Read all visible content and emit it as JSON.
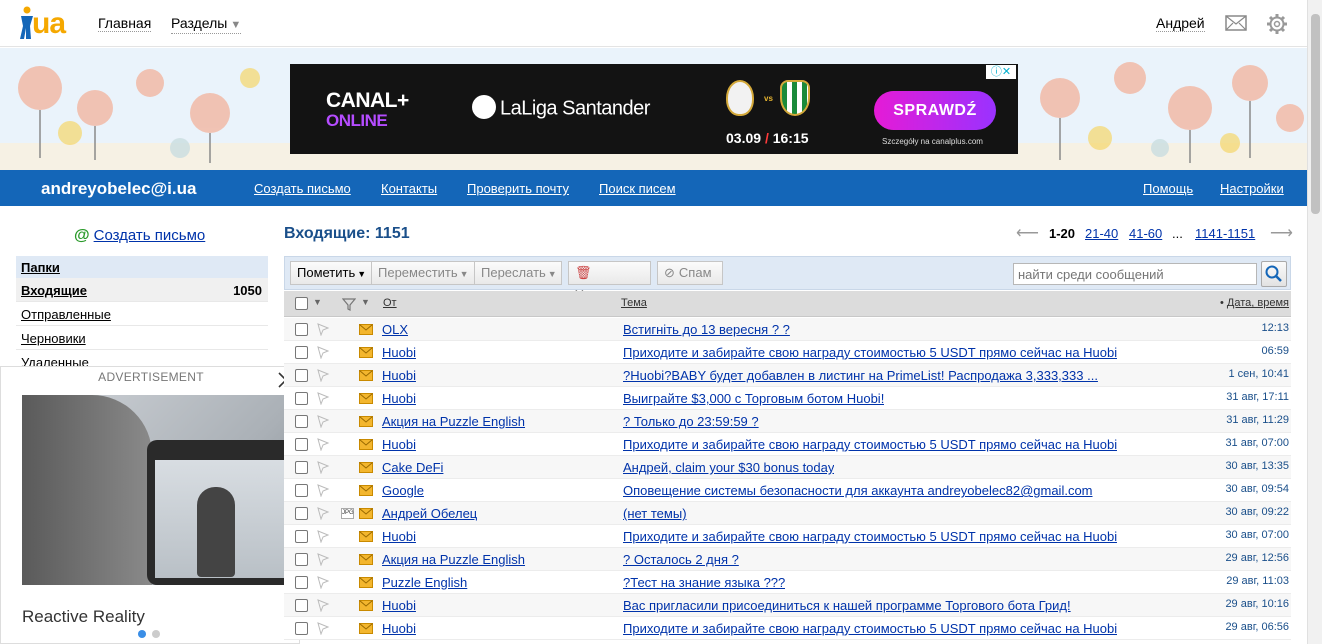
{
  "header": {
    "logo_text": "ua",
    "nav_main": "Главная",
    "nav_sections": "Разделы",
    "user_name": "Андрей"
  },
  "banner_ad": {
    "brand": "CANAL+",
    "brand_sub": "ONLINE",
    "league": "LaLiga Santander",
    "vs": "vs",
    "date": "03.09",
    "time": "16:15",
    "cta": "SPRAWDŹ",
    "small": "Szczegóły na canalplus.com"
  },
  "bluebar": {
    "email": "andreyobelec@i.ua",
    "links": [
      "Создать письмо",
      "Контакты",
      "Проверить почту",
      "Поиск писем"
    ],
    "help": "Помощь",
    "settings": "Настройки"
  },
  "sidebar": {
    "compose": "Создать письмо",
    "folders_header": "Папки",
    "folders": [
      {
        "label": "Входящие",
        "count": "1050"
      },
      {
        "label": "Отправленные",
        "count": ""
      },
      {
        "label": "Черновики",
        "count": ""
      },
      {
        "label": "Удаленные",
        "count": ""
      }
    ]
  },
  "float_ad": {
    "label": "ADVERTISEMENT",
    "caption": "Reactive Reality"
  },
  "inbox": {
    "title": "Входящие: 1151",
    "pager": {
      "current": "1-20",
      "pages": [
        "21-40",
        "41-60",
        "1141-1151"
      ],
      "ellipsis": "..."
    }
  },
  "toolbar": {
    "mark": "Пометить",
    "move": "Переместить",
    "forward": "Переслать",
    "delete": "Удалить",
    "spam": "Спам",
    "search_placeholder": "найти среди сообщений"
  },
  "columns": {
    "from": "От",
    "subject": "Тема",
    "date": "Дата, время"
  },
  "messages": [
    {
      "from": "OLX",
      "subject": "Встигніть до 13 вересня ? ?",
      "date": "12:13",
      "attach": false
    },
    {
      "from": "Huobi",
      "subject": "Приходите и забирайте свою награду стоимостью 5 USDT прямо сейчас на Huobi",
      "date": "06:59",
      "attach": false
    },
    {
      "from": "Huobi",
      "subject": "?Huobi?BABY будет добавлен в листинг на PrimeList! Распродажа 3,333,333 ...",
      "date": "1 сен, 10:41",
      "attach": false
    },
    {
      "from": "Huobi",
      "subject": "Выиграйте $3,000 с Торговым ботом Huobi!",
      "date": "31 авг, 17:11",
      "attach": false
    },
    {
      "from": "Акция на Puzzle English",
      "subject": "? Только до 23:59:59 ?",
      "date": "31 авг, 11:29",
      "attach": false
    },
    {
      "from": "Huobi",
      "subject": "Приходите и забирайте свою награду стоимостью 5 USDT прямо сейчас на Huobi",
      "date": "31 авг, 07:00",
      "attach": false
    },
    {
      "from": "Cake DeFi",
      "subject": "Андрей, claim your $30 bonus today",
      "date": "30 авг, 13:35",
      "attach": false
    },
    {
      "from": "Google",
      "subject": "Оповещение системы безопасности для аккаунта andreyobelec82@gmail.com",
      "date": "30 авг, 09:54",
      "attach": false
    },
    {
      "from": "Андрей Обелец",
      "subject": "(нет темы)",
      "date": "30 авг, 09:22",
      "attach": true,
      "attach_label": "JPG"
    },
    {
      "from": "Huobi",
      "subject": "Приходите и забирайте свою награду стоимостью 5 USDT прямо сейчас на Huobi",
      "date": "30 авг, 07:00",
      "attach": false
    },
    {
      "from": "Акция на Puzzle English",
      "subject": "? Осталось 2 дня ?",
      "date": "29 авг, 12:56",
      "attach": false
    },
    {
      "from": "Puzzle English",
      "subject": "?Тест на знание языка ???",
      "date": "29 авг, 11:03",
      "attach": false
    },
    {
      "from": "Huobi",
      "subject": "Вас пригласили присоединиться к нашей программе Торгового бота Грид!",
      "date": "29 авг, 10:16",
      "attach": false
    },
    {
      "from": "Huobi",
      "subject": "Приходите и забирайте свою награду стоимостью 5 USDT прямо сейчас на Huobi",
      "date": "29 авг, 06:56",
      "attach": false
    }
  ]
}
